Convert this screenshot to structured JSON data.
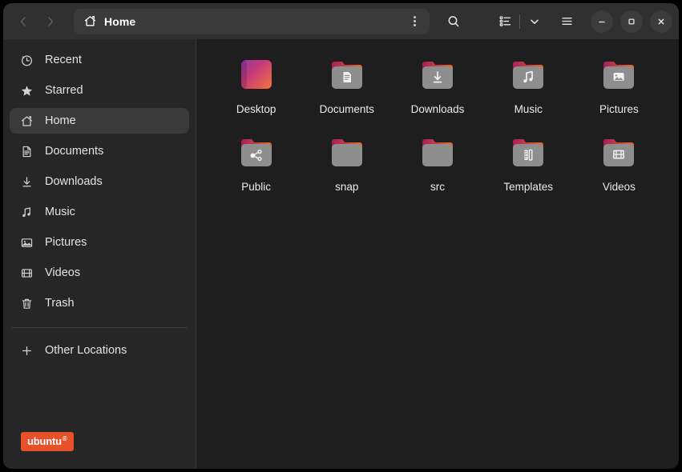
{
  "window": {
    "title": "Home",
    "app": "files-nautilus"
  },
  "headerbar": {
    "back_label": "Back",
    "forward_label": "Forward",
    "path_icon": "home-icon",
    "path_label": "Home",
    "path_menu_label": "Path options",
    "search_label": "Search",
    "view_toggle_label": "List view",
    "view_dropdown_label": "View options",
    "menu_label": "Main menu",
    "minimize_label": "Minimize",
    "maximize_label": "Maximize",
    "close_label": "Close"
  },
  "sidebar": {
    "items": [
      {
        "label": "Recent",
        "icon": "clock-icon",
        "selected": false
      },
      {
        "label": "Starred",
        "icon": "star-icon",
        "selected": false
      },
      {
        "label": "Home",
        "icon": "home-icon",
        "selected": true
      },
      {
        "label": "Documents",
        "icon": "document-icon",
        "selected": false
      },
      {
        "label": "Downloads",
        "icon": "download-icon",
        "selected": false
      },
      {
        "label": "Music",
        "icon": "music-icon",
        "selected": false
      },
      {
        "label": "Pictures",
        "icon": "image-icon",
        "selected": false
      },
      {
        "label": "Videos",
        "icon": "film-icon",
        "selected": false
      },
      {
        "label": "Trash",
        "icon": "trash-icon",
        "selected": false
      }
    ],
    "other_locations": {
      "label": "Other Locations",
      "icon": "plus-icon"
    },
    "badge": {
      "text": "ubuntu",
      "superscript": "®",
      "color": "#e8502a"
    }
  },
  "files": [
    {
      "name": "Desktop",
      "type": "gradient-square",
      "emblem": "none"
    },
    {
      "name": "Documents",
      "type": "folder",
      "emblem": "document-icon"
    },
    {
      "name": "Downloads",
      "type": "folder",
      "emblem": "download-icon"
    },
    {
      "name": "Music",
      "type": "folder",
      "emblem": "music-icon"
    },
    {
      "name": "Pictures",
      "type": "folder",
      "emblem": "image-icon"
    },
    {
      "name": "Public",
      "type": "folder",
      "emblem": "share-icon"
    },
    {
      "name": "snap",
      "type": "folder",
      "emblem": "none"
    },
    {
      "name": "src",
      "type": "folder",
      "emblem": "none"
    },
    {
      "name": "Templates",
      "type": "folder",
      "emblem": "template-icon"
    },
    {
      "name": "Videos",
      "type": "folder",
      "emblem": "film-icon"
    }
  ],
  "colors": {
    "window_bg": "#1e1e1e",
    "header_bg": "#303030",
    "sidebar_bg": "#262626",
    "selected_bg": "#3a3a3a",
    "accent_orange": "#e8502a",
    "folder_body": "#8e8e8e",
    "folder_tab_start": "#a41f5b",
    "folder_tab_end": "#f0662a",
    "text": "#e3e3e3"
  }
}
